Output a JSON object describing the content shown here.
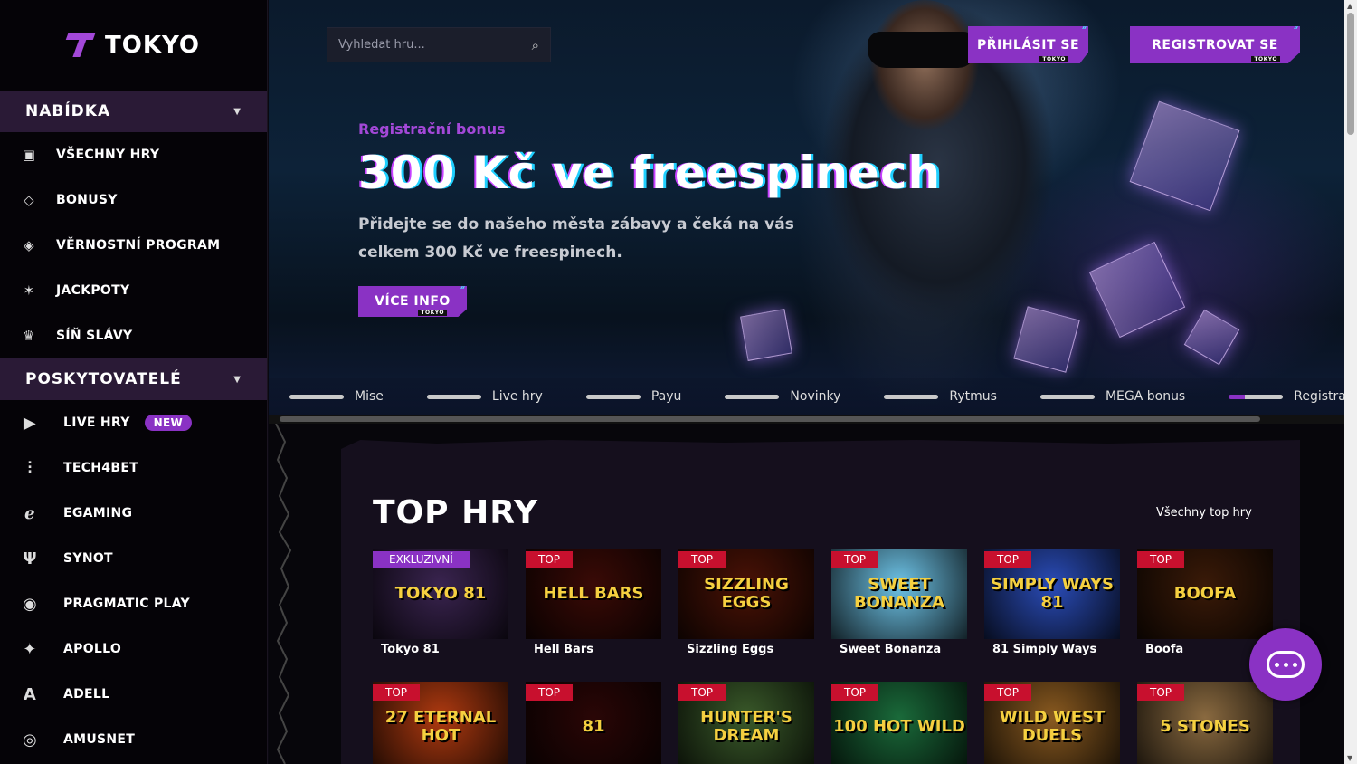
{
  "brand": {
    "name": "TOKYO",
    "accent": "#8a32c4"
  },
  "sidebar": {
    "offer_title": "NABÍDKA",
    "offer_items": [
      {
        "label": "VŠECHNY HRY",
        "icon": "games-icon"
      },
      {
        "label": "BONUSY",
        "icon": "diamond-icon"
      },
      {
        "label": "VĚRNOSTNÍ PROGRAM",
        "icon": "tag-icon"
      },
      {
        "label": "JACKPOTY",
        "icon": "jackpot-icon"
      },
      {
        "label": "SÍŇ SLÁVY",
        "icon": "crown-icon"
      }
    ],
    "providers_title": "POSKYTOVATELÉ",
    "providers": [
      {
        "label": "LIVE HRY",
        "icon": "live-icon",
        "badge": "NEW"
      },
      {
        "label": "TECH4BET",
        "icon": "tech4bet-icon"
      },
      {
        "label": "EGAMING",
        "icon": "egaming-icon"
      },
      {
        "label": "SYNOT",
        "icon": "synot-icon"
      },
      {
        "label": "PRAGMATIC PLAY",
        "icon": "pragmatic-icon"
      },
      {
        "label": "APOLLO",
        "icon": "apollo-icon"
      },
      {
        "label": "ADELL",
        "icon": "adell-icon"
      },
      {
        "label": "AMUSNET",
        "icon": "amusnet-icon"
      }
    ]
  },
  "header": {
    "search_placeholder": "Vyhledat hru...",
    "login_label": "PŘIHLÁSIT SE",
    "register_label": "REGISTROVAT SE",
    "mini_tag": "TOKYO"
  },
  "hero": {
    "subtitle": "Registrační bonus",
    "title": "300 Kč ve freespinech",
    "text": "Přidejte se do našeho města zábavy a čeká na vás celkem 300 Kč ve freespinech.",
    "button": "VÍCE INFO"
  },
  "hero_tabs": [
    "Mise",
    "Live hry",
    "Payu",
    "Novinky",
    "Rytmus",
    "MEGA bonus",
    "Registra"
  ],
  "top_games": {
    "title": "TOP HRY",
    "all_link": "Všechny top hry",
    "row1": [
      {
        "name": "Tokyo 81",
        "label": "EXKLUZIVNÍ",
        "art": "TOKYO 81",
        "bg": "#3a2450"
      },
      {
        "name": "Hell Bars",
        "label": "TOP",
        "art": "HELL BARS",
        "bg": "#3a0a06"
      },
      {
        "name": "Sizzling Eggs",
        "label": "TOP",
        "art": "SIZZLING EGGS",
        "bg": "#4a1206"
      },
      {
        "name": "Sweet Bonanza",
        "label": "TOP",
        "art": "SWEET BONANZA",
        "bg": "#6ec4e8"
      },
      {
        "name": "81 Simply Ways",
        "label": "TOP",
        "art": "SIMPLY WAYS 81",
        "bg": "#2a4cb8"
      },
      {
        "name": "Boofa",
        "label": "TOP",
        "art": "BOOFA",
        "bg": "#3a1a08"
      }
    ],
    "row2": [
      {
        "label": "TOP",
        "art": "27 ETERNAL HOT",
        "bg": "#b03a10"
      },
      {
        "label": "TOP",
        "art": "81",
        "bg": "#2a0606"
      },
      {
        "label": "TOP",
        "art": "HUNTER'S DREAM",
        "bg": "#3a5a2a"
      },
      {
        "label": "TOP",
        "art": "100 HOT WILD",
        "bg": "#1a6a3a"
      },
      {
        "label": "TOP",
        "art": "WILD WEST DUELS",
        "bg": "#8a5a20"
      },
      {
        "label": "TOP",
        "art": "5 STONES",
        "bg": "#8a6a40"
      }
    ]
  }
}
